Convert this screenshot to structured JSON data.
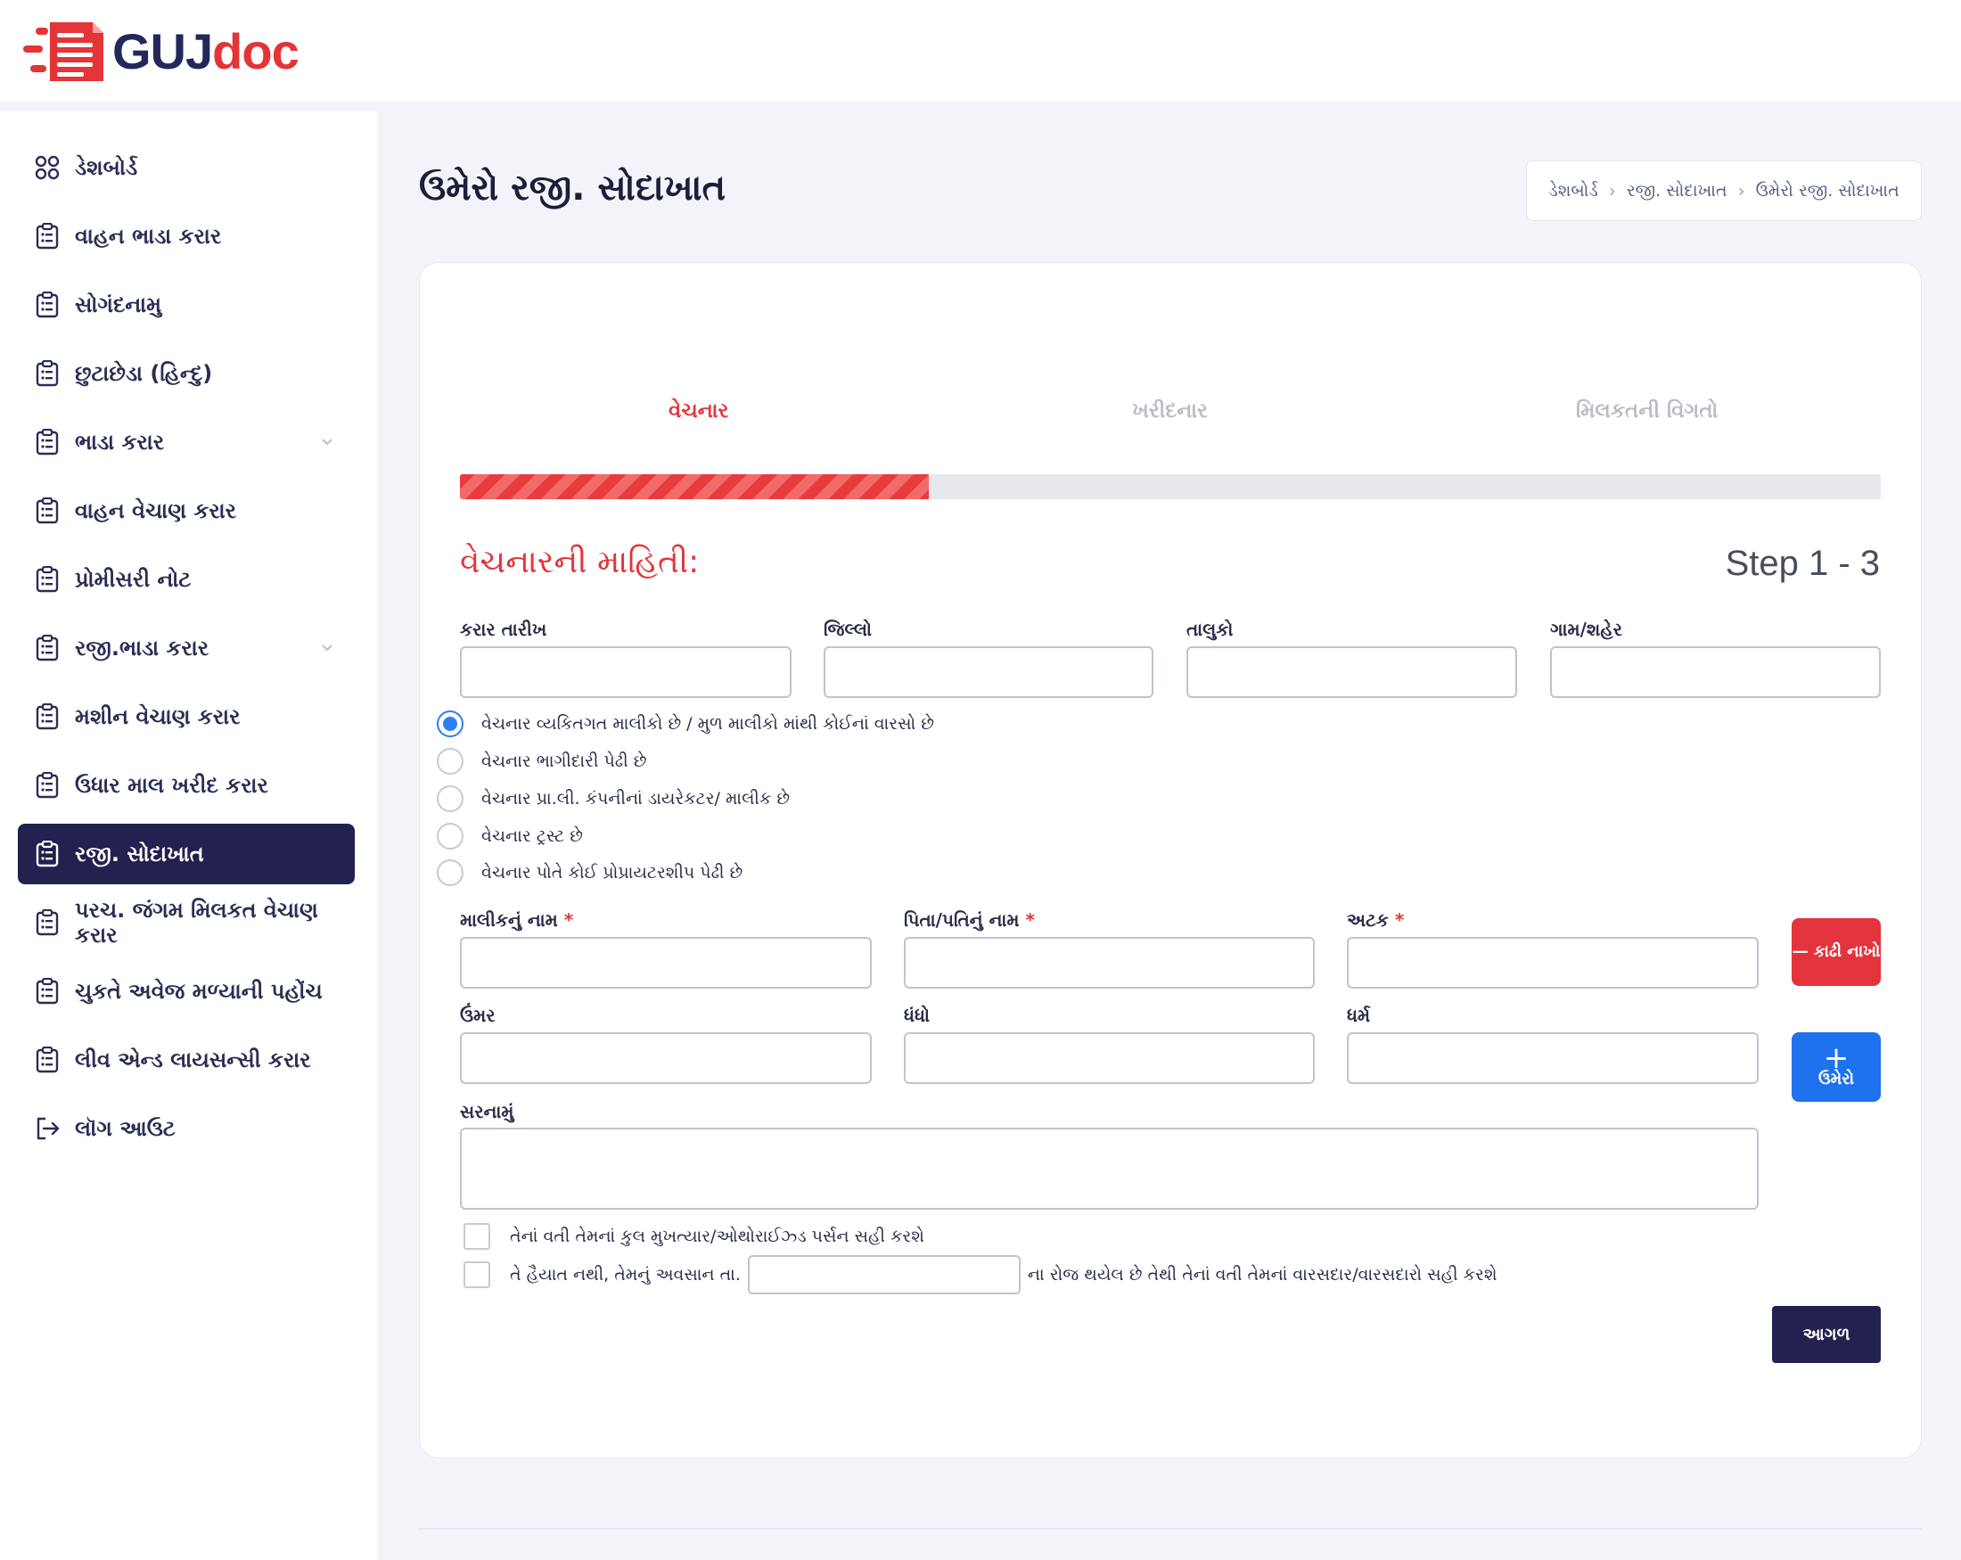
{
  "brand": {
    "logo_part1": "GUJ",
    "logo_part2": "doc",
    "primary_color": "#23214f",
    "accent_color": "#e3363b",
    "info_color": "#1f72ee"
  },
  "sidebar": {
    "items": [
      {
        "label": "ડેશબોર્ડ",
        "icon": "grid-icon"
      },
      {
        "label": "વાહન ભાડા કરાર",
        "icon": "clipboard-icon"
      },
      {
        "label": "સોગંદનામુ",
        "icon": "clipboard-icon"
      },
      {
        "label": "છુટાછેડા (હિન્દુ)",
        "icon": "clipboard-icon"
      },
      {
        "label": "ભાડા કરાર",
        "icon": "clipboard-icon",
        "has_submenu": true
      },
      {
        "label": "વાહન વેચાણ કરાર",
        "icon": "clipboard-icon"
      },
      {
        "label": "પ્રોમીસરી નોટ",
        "icon": "clipboard-icon"
      },
      {
        "label": "રજી.ભાડા કરાર",
        "icon": "clipboard-icon",
        "has_submenu": true
      },
      {
        "label": "મશીન વેચાણ કરાર",
        "icon": "clipboard-icon"
      },
      {
        "label": "ઉધાર માલ ખરીદ કરાર",
        "icon": "clipboard-icon"
      },
      {
        "label": "રજી. સોદાખાત",
        "icon": "clipboard-icon",
        "active": true
      },
      {
        "label": "પરચ. જંગમ મિલકત વેચાણ કરાર",
        "icon": "clipboard-icon"
      },
      {
        "label": "ચુકતે અવેજ મળ્યાની પહોંચ",
        "icon": "clipboard-icon"
      },
      {
        "label": "લીવ એન્ડ લાયસન્સી કરાર",
        "icon": "clipboard-icon"
      },
      {
        "label": "લૉગ આઉટ",
        "icon": "logout-icon"
      }
    ]
  },
  "page": {
    "title": "ઉમેરો રજી. સોદાખાત",
    "breadcrumb": [
      "ડેશબોર્ડ",
      "રજી. સોદાખાત",
      "ઉમેરો રજી. સોદાખાત"
    ]
  },
  "wizard": {
    "steps": [
      "વેચનાર",
      "ખરીદનાર",
      "મિલકતની વિગતો"
    ],
    "active_step": 0,
    "progress_fraction": 0.33,
    "section_title": "વેચનારની માહિતી:",
    "step_count": "Step 1 - 3"
  },
  "form": {
    "date_label": "કરાર તારીખ",
    "district_label": "જિલ્લો",
    "taluka_label": "તાલુકો",
    "village_label": "ગામ/શહેર",
    "seller_types": [
      {
        "label": "વેચનાર વ્યકિતગત માલીકો છે / મુળ માલીકો માંથી કોઈનાં વારસો છે",
        "checked": true
      },
      {
        "label": "વેચનાર ભાગીદારી પેઢી છે",
        "checked": false
      },
      {
        "label": "વેચનાર પ્રા.લી. કંપનીનાં ડાયરેકટર/ માલીક છે",
        "checked": false
      },
      {
        "label": "વેચનાર ટ્રસ્ટ છે",
        "checked": false
      },
      {
        "label": "વેચનાર પોતે કોઈ પ્રોપ્રાયટરશીપ પેઢી છે",
        "checked": false
      }
    ],
    "owner_name_label": "માલીકનું નામ",
    "father_name_label": "પિતા/પતિનું નામ",
    "surname_label": "અટક",
    "age_label": "ઉંમર",
    "occupation_label": "ધંધો",
    "religion_label": "ધર્મ",
    "address_label": "સરનામું",
    "required_mark": "*",
    "remove_button": "— કાઢી નાખો",
    "add_button_icon": "+",
    "add_button": "ઉમેરો",
    "poa_checkbox": "તેનાં વતી તેમનાં કુલ મુખત્યાર/ઓથોરાઈઝ્ડ પર્સન સહી કરશે",
    "deceased_prefix": "તે હૈયાત નથી, તેમનું અવસાન તા.",
    "deceased_suffix": "ના રોજ થયેલ છે તેથી તેનાં વતી તેમનાં વારસદાર/વારસદારો સહી કરશે",
    "next_button": "આગળ"
  }
}
